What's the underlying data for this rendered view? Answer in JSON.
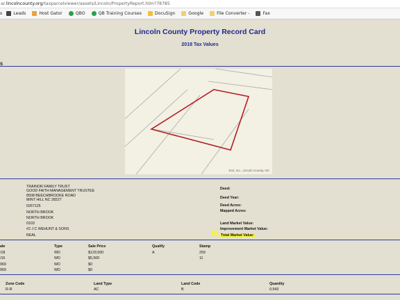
{
  "browser": {
    "url_prefix": "ar.",
    "url_host": "lincolncounty.org",
    "url_path": "/taxparcelviewer/assets/Lincoln/PropertyReport.htm?78785",
    "bookmarks": [
      {
        "label": "s",
        "icon": "apps-icon"
      },
      {
        "label": "Leads",
        "icon": "bookmark-icon"
      },
      {
        "label": "Host Gator",
        "icon": "bookmark-icon"
      },
      {
        "label": "QBO",
        "icon": "bookmark-icon"
      },
      {
        "label": "QB Training Courses",
        "icon": "bookmark-icon"
      },
      {
        "label": "DocuSign",
        "icon": "bookmark-icon"
      },
      {
        "label": "Google",
        "icon": "folder-icon"
      },
      {
        "label": "File Converter -",
        "icon": "folder-icon"
      },
      {
        "label": "Fax",
        "icon": "bookmark-icon"
      }
    ],
    "colors": [
      "#444444",
      "#e8a33a",
      "#3a6fc4",
      "#2aa04a",
      "#2b6fc1",
      "#f2c230",
      "#f0d070",
      "#f0d070",
      "#555555"
    ]
  },
  "header": {
    "title": "Lincoln County Property Record Card",
    "subtitle": "2018 Tax Values",
    "section_label": "S"
  },
  "map": {
    "credit": "Esri, Inc., Lincoln County, NC"
  },
  "owner": {
    "name1": "TRAINOR FAMILY TRUST",
    "name2": "GOOD FAITH MANAGEMENT TRUSTEE",
    "address1": "8508 BEECHBROOKE ROAD",
    "address2": "MINT HILL NC 28227",
    "parcel": "0267125",
    "sub1": "NORTH BROOK",
    "sub2": "NORTH BROOK",
    "code": "0103",
    "builder": "#2 J C WEHUNT & SONS",
    "type": "REAL"
  },
  "deed_labels": {
    "deed": "Deed:",
    "deed_year": "Deed Year:",
    "deed_acres": "Deed Acres:",
    "mapped_acres": "Mapped Acres:",
    "land_market": "Land Market Value:",
    "improvement_market": "Improvement Market Value:",
    "total_market": "Total Market Value:"
  },
  "sales": {
    "headers": [
      "ale",
      "Type",
      "Sale Price",
      "Qualify",
      "Stamp"
    ],
    "rows": [
      [
        "/18",
        "WD",
        "$129,500",
        "A",
        "259"
      ],
      [
        "/16",
        "WD",
        "$5,500",
        "",
        "11"
      ],
      [
        "969",
        "WD",
        "$0",
        "",
        ""
      ],
      [
        "969",
        "WD",
        "$0",
        "",
        ""
      ]
    ]
  },
  "land": {
    "headers": [
      "Zone Code",
      "Land Type",
      "Land Code",
      "Quantity"
    ],
    "row": [
      "R-R",
      "AC",
      "B",
      "0.943"
    ]
  },
  "accent": "#1c2a8c",
  "parcel_outline": "#b41e24",
  "highlight": "#f4f24a"
}
